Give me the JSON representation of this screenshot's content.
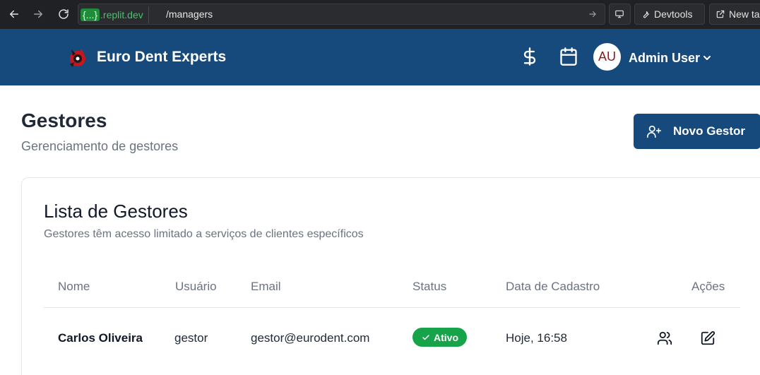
{
  "browser": {
    "url_host_braces": "{...}",
    "url_host_rest": ".replit.dev",
    "url_path": "/managers",
    "devtools_label": "Devtools",
    "new_tab_label": "New tab"
  },
  "header": {
    "brand": "Euro Dent Experts",
    "user_initials": "AU",
    "user_name": "Admin User",
    "icons": [
      "dollar-icon",
      "calendar-icon",
      "chevron-down-icon"
    ]
  },
  "page": {
    "title": "Gestores",
    "subtitle": "Gerenciamento de gestores",
    "new_button_label": "Novo Gestor"
  },
  "list": {
    "title": "Lista de Gestores",
    "description": "Gestores têm acesso limitado a serviços de clientes específicos",
    "columns": [
      "Nome",
      "Usuário",
      "Email",
      "Status",
      "Data de Cadastro",
      "Ações"
    ],
    "rows": [
      {
        "name": "Carlos Oliveira",
        "username": "gestor",
        "email": "gestor@eurodent.com",
        "status": "Ativo",
        "created": "Hoje, 16:58"
      }
    ]
  },
  "colors": {
    "brand": "#164a7d",
    "status_active": "#16a34a"
  }
}
